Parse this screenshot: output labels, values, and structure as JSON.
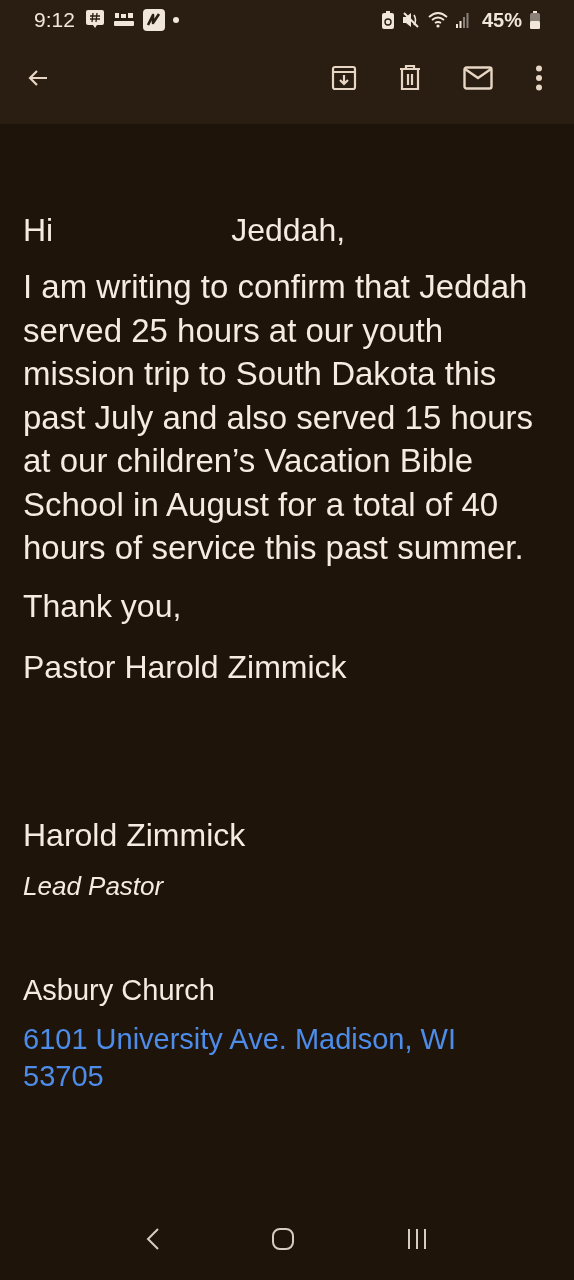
{
  "status_bar": {
    "time": "9:12",
    "battery": "45%"
  },
  "message": {
    "greeting": [
      "Hi",
      "Jeddah,"
    ],
    "body": "I am writing to confirm that Jeddah served 25 hours at our youth mission trip to South Dakota this past July and also served 15 hours at our children’s Vacation Bible School in August for a total of 40 hours of service this past summer.",
    "closing": "Thank you,",
    "signoff": "Pastor Harold Zimmick",
    "signature": {
      "name": "Harold Zimmick",
      "title": "Lead Pastor",
      "organization": "Asbury Church",
      "address": "6101 University Ave. Madison, WI 53705"
    }
  }
}
